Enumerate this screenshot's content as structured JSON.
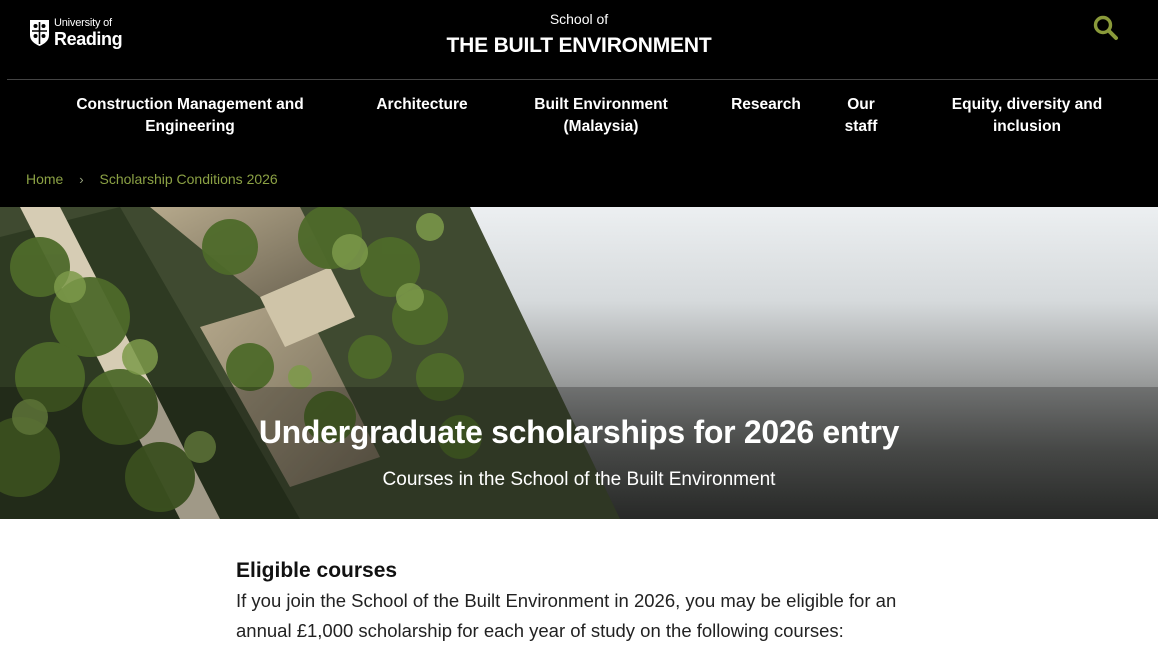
{
  "header": {
    "logo": {
      "line1": "University of",
      "line2": "Reading",
      "icon": "shield-crest-icon"
    },
    "school_prefix": "School of",
    "school_name": "THE BUILT ENVIRONMENT",
    "search_icon": "search-icon",
    "search_icon_color": "#8a9a3a"
  },
  "nav": {
    "items": [
      {
        "label": "Construction Management and Engineering"
      },
      {
        "label": "Architecture"
      },
      {
        "label": "Built Environment (Malaysia)"
      },
      {
        "label": "Research"
      },
      {
        "label": "Our staff"
      },
      {
        "label": "Equity, diversity and inclusion"
      }
    ]
  },
  "breadcrumb": {
    "home": "Home",
    "separator": "›",
    "current": "Scholarship Conditions 2026",
    "color": "#8ba144"
  },
  "hero": {
    "title": "Undergraduate scholarships for 2026 entry",
    "subtitle": "Courses in the School of the Built Environment"
  },
  "content": {
    "heading": "Eligible courses",
    "body": "If you join the School of the Built Environment in 2026, you may be eligible for an annual £1,000 scholarship for each year of study on the following courses:"
  }
}
